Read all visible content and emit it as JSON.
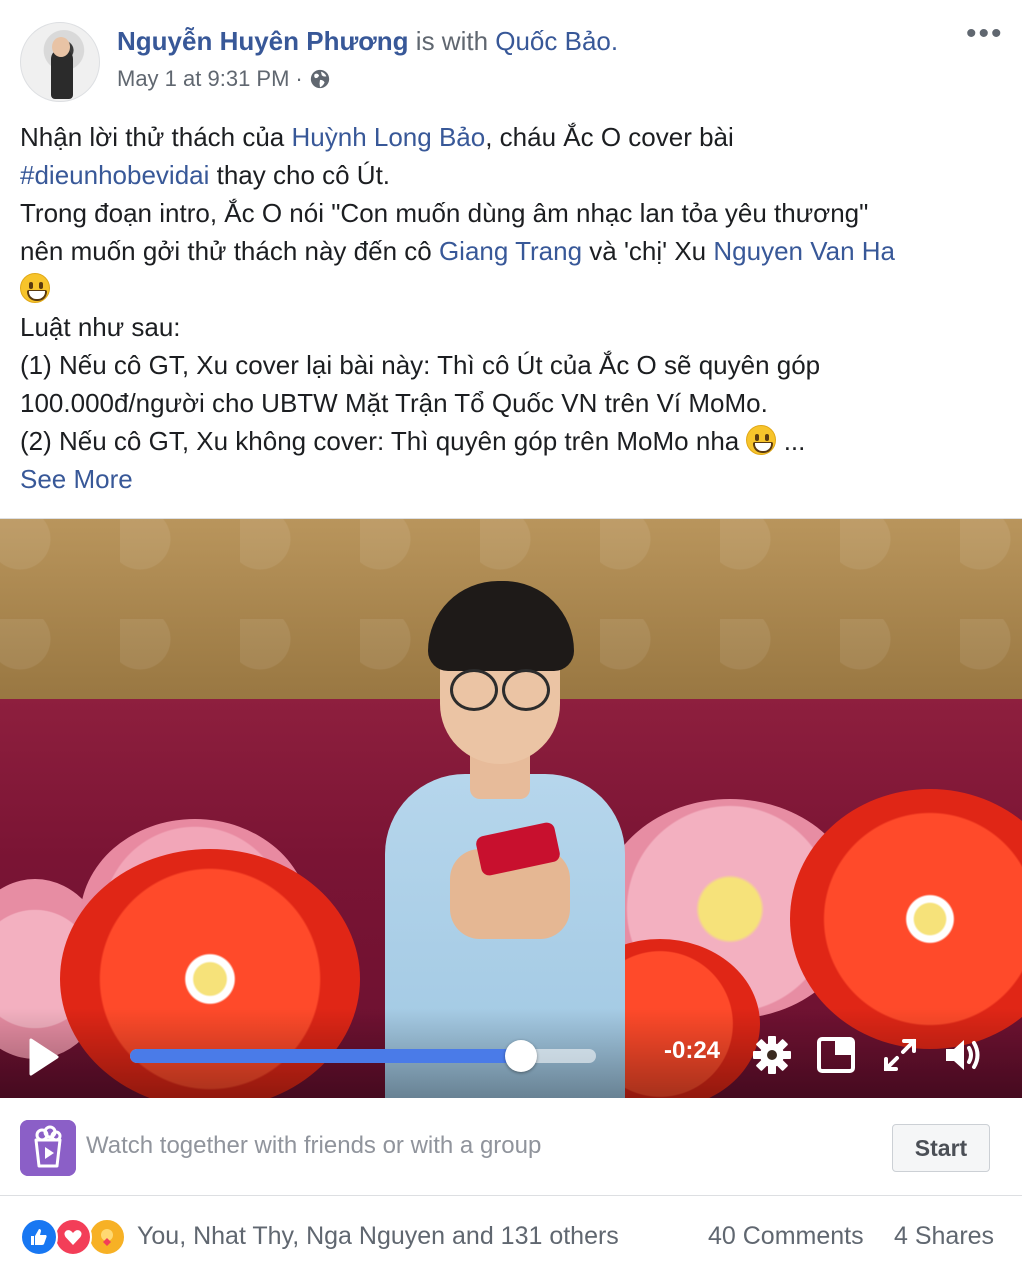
{
  "post": {
    "author": "Nguyễn Huyên Phương",
    "with_text": " is with ",
    "tagged": "Quốc Bảo.",
    "timestamp": "May 1 at 9:31 PM",
    "separator": " · ",
    "privacy_icon": "globe-icon",
    "more_icon": "more-options-icon",
    "more_glyph": "•••"
  },
  "body": {
    "l1_a": "Nhận lời thử thách của ",
    "l1_link": "Huỳnh Long Bảo",
    "l1_b": ", cháu Ắc O cover bài",
    "l2_hashtag": "#dieunhobevidai",
    "l2_b": " thay cho cô Út.",
    "l3": "Trong đoạn intro, Ắc O nói \"Con muốn dùng âm nhạc lan tỏa yêu thương\"",
    "l4_a": "nên muốn gởi thử thách này đến cô ",
    "l4_link1": "Giang Trang",
    "l4_b": " và 'chị' Xu ",
    "l4_link2": "Nguyen Van Ha",
    "l6": "Luật như sau:",
    "l7": "(1) Nếu cô GT, Xu cover lại bài này: Thì cô Út của Ắc O sẽ quyên góp",
    "l8": "100.000đ/người cho UBTW Mặt Trận Tổ Quốc VN trên Ví MoMo.",
    "l9_a": "(2) Nếu cô GT, Xu không cover: Thì quyên góp trên MoMo nha ",
    "l9_b": " ...",
    "see_more": "See More"
  },
  "video": {
    "time_remaining": "-0:24",
    "progress": 0.84,
    "accent": "#4a7be8"
  },
  "watch": {
    "text": "Watch together with friends or with a group",
    "start_label": "Start",
    "icon": "watch-party-icon"
  },
  "footer": {
    "reactions": [
      "like",
      "love",
      "care"
    ],
    "reaction_names": "You, Nhat Thy, Nga Nguyen and 131 others",
    "comments": "40 Comments",
    "shares": "4 Shares"
  },
  "colors": {
    "link": "#385898",
    "secondary_text": "#606770",
    "like": "#1877f2",
    "love": "#f33e58",
    "care": "#f7b125"
  }
}
